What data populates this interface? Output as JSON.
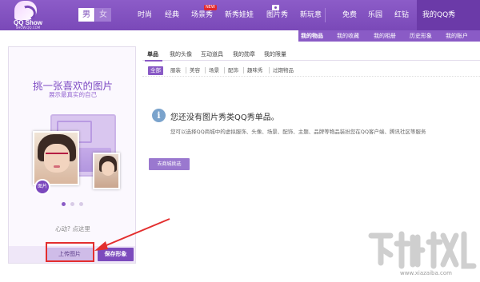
{
  "logo": {
    "text": "QQ Show",
    "sub": "SHOW.QQ.COM"
  },
  "gender": {
    "male": "男",
    "female": "女"
  },
  "nav": {
    "items": [
      "时尚",
      "经典",
      "场景秀",
      "新秀娃娃",
      "图片秀",
      "新玩意",
      "免费",
      "乐园",
      "红钻",
      "我的QQ秀"
    ],
    "new_badge": "NEW",
    "active": "我的QQ秀"
  },
  "subnav": {
    "items": [
      "我的物品",
      "我的收藏",
      "我的相册",
      "历史形象",
      "我的账户"
    ],
    "active": "我的物品"
  },
  "left_panel": {
    "title": "挑一张喜欢的图片",
    "subtitle": "展示最真实的自己",
    "badge": "图片",
    "hint": "心动? 点这里",
    "upload_button": "上传图片",
    "save_button": "保存形象",
    "carousel": {
      "count": 3,
      "active_index": 0
    }
  },
  "tabs": {
    "items": [
      "单品",
      "我的头像",
      "互动道具",
      "我的勋章",
      "我的限量"
    ],
    "active": "单品"
  },
  "filters": {
    "items": [
      "全部",
      "服装",
      "美容",
      "场景",
      "配饰",
      "趣味秀",
      "过期物品"
    ],
    "active": "全部"
  },
  "message": {
    "title": "您还没有图片秀类QQ秀单品。",
    "description": "您可以选择QQ商城中的虚拟服饰、头像、场景、配饰、主题、品牌等物品装扮您在QQ客户端、腾讯社区等服务",
    "button": "去商城挑选"
  },
  "watermark": {
    "url": "www.xiazaiba.com"
  },
  "colors": {
    "brand": "#7a49b8",
    "accent": "#8a5bc6",
    "highlight": "#e32e2e",
    "info": "#7aa3cc"
  }
}
